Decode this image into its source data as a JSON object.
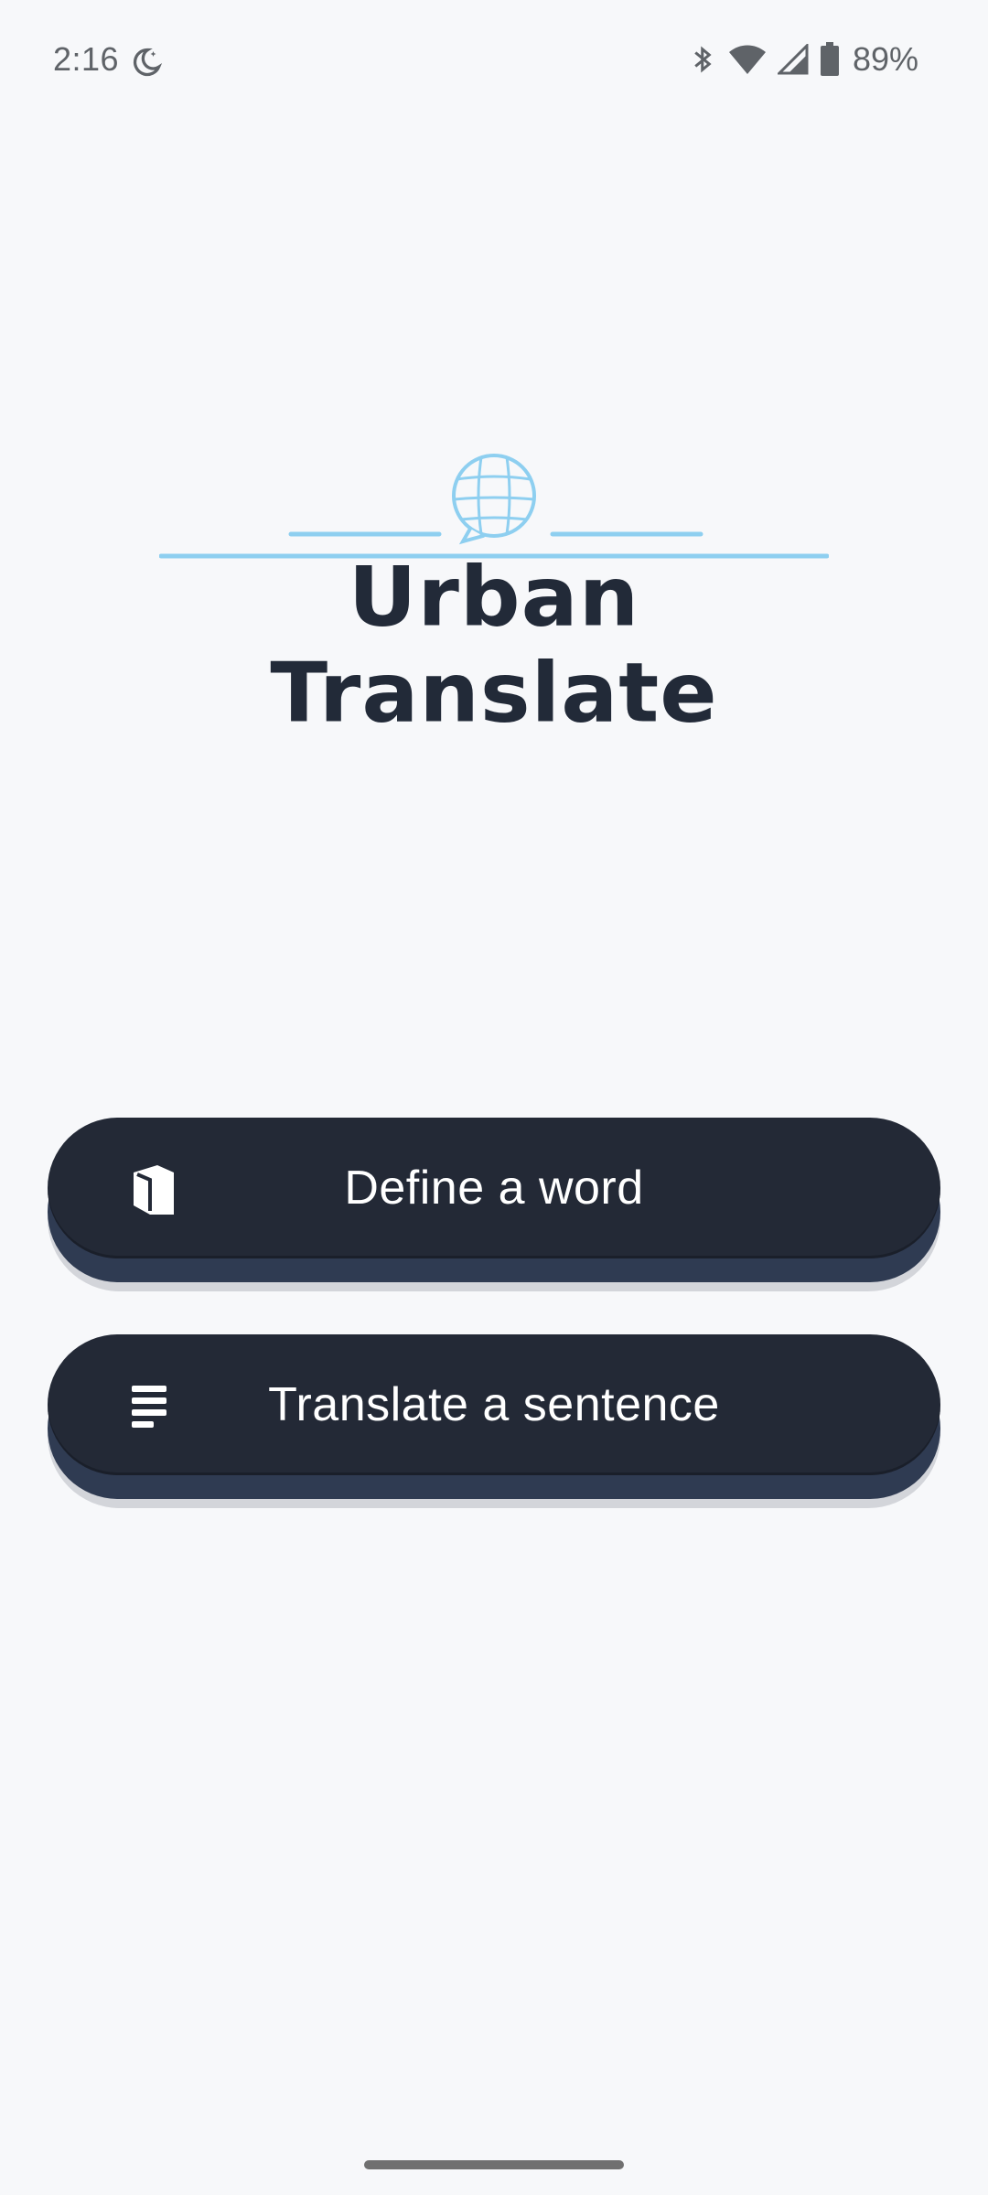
{
  "status_bar": {
    "time": "2:16",
    "battery_text": "89%",
    "icons": [
      "moon-icon",
      "bluetooth-icon",
      "wifi-icon",
      "signal-icon",
      "battery-icon"
    ]
  },
  "logo": {
    "title": "Urban Translate",
    "emblem_icon": "globe-speech-bubble-icon",
    "accent_color": "#8ecff0"
  },
  "buttons": {
    "define": {
      "label": "Define a word",
      "icon": "book-icon"
    },
    "translate": {
      "label": "Translate a sentence",
      "icon": "text-lines-icon"
    }
  },
  "colors": {
    "background": "#f7f8fa",
    "button_face": "#232936",
    "button_base": "#2f3b52",
    "title": "#222a38"
  }
}
